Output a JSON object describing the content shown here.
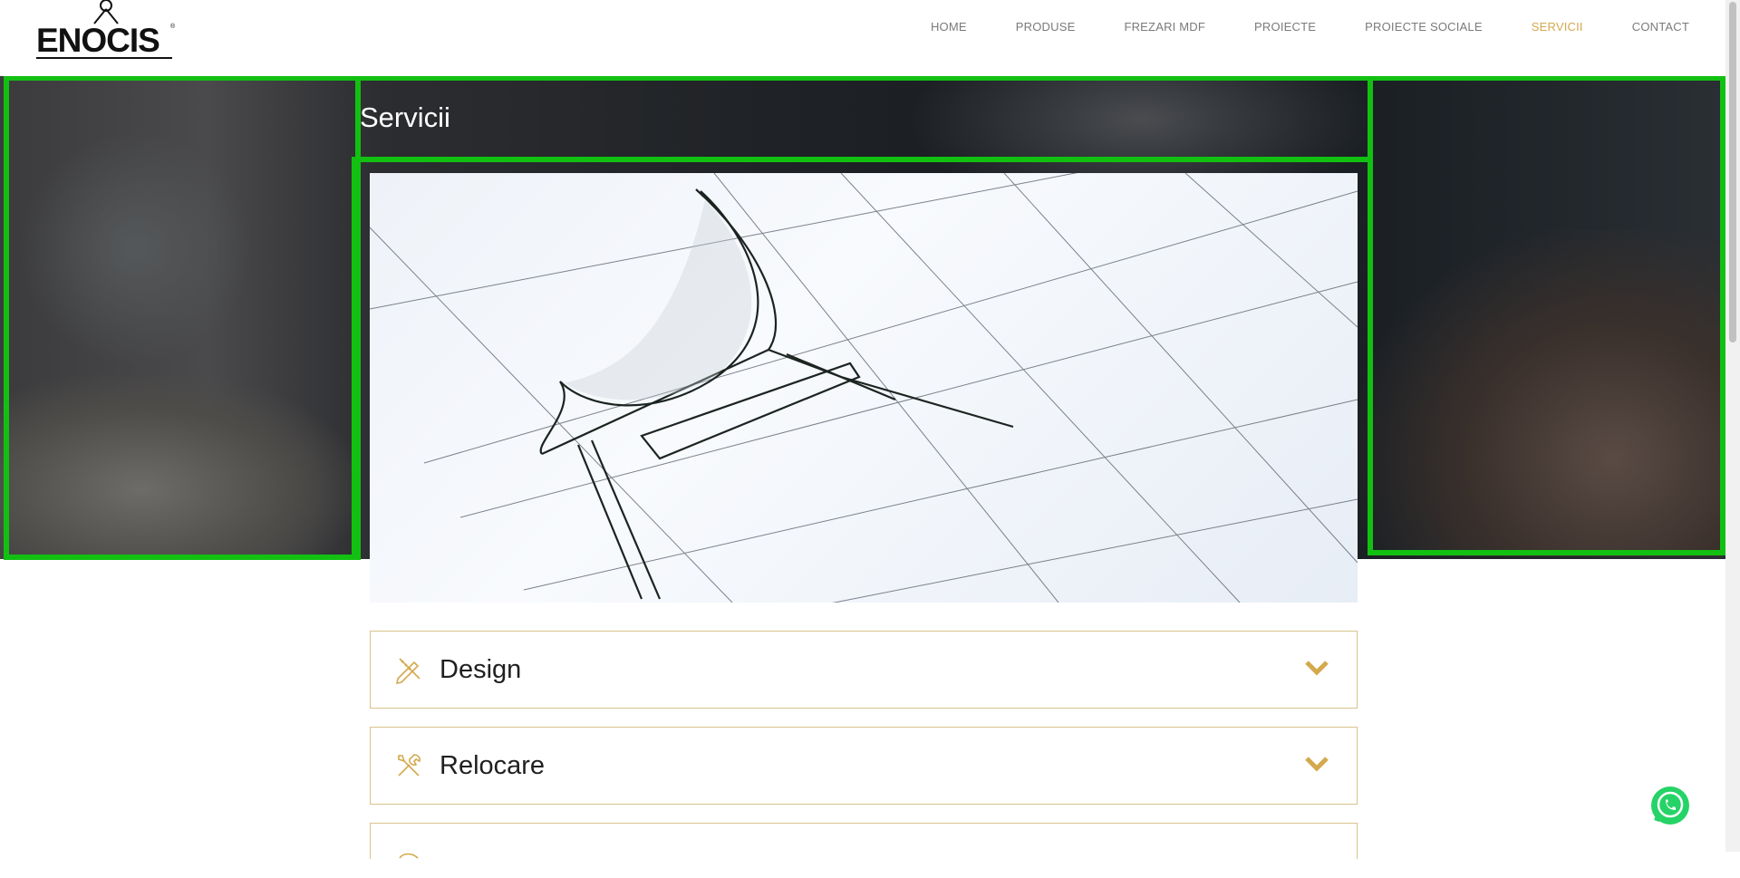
{
  "header": {
    "logo_text": "ENOCIS",
    "nav": [
      {
        "label": "HOME",
        "active": false
      },
      {
        "label": "PRODUSE",
        "active": false
      },
      {
        "label": "FREZARI MDF",
        "active": false
      },
      {
        "label": "PROIECTE",
        "active": false
      },
      {
        "label": "PROIECTE SOCIALE",
        "active": false
      },
      {
        "label": "SERVICII",
        "active": true
      },
      {
        "label": "CONTACT",
        "active": false
      }
    ]
  },
  "hero": {
    "title": "Servicii"
  },
  "accordion": [
    {
      "label": "Design",
      "icon": "pencil-ruler-icon"
    },
    {
      "label": "Relocare",
      "icon": "tools-icon"
    },
    {
      "label": "",
      "icon": "partial-icon"
    }
  ],
  "colors": {
    "accent": "#d4a94e",
    "border": "#d9c48b",
    "highlight_frame": "#12c012",
    "whatsapp": "#25d366"
  }
}
